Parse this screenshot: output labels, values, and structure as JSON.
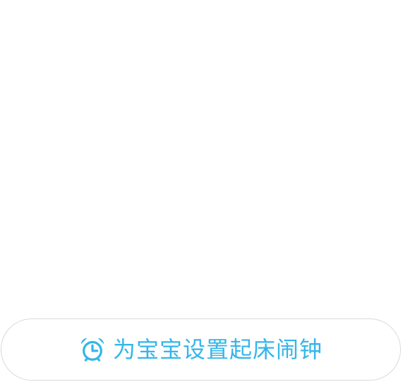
{
  "colors": {
    "accent": "#33b6ea",
    "border": "#d9d9d9",
    "background": "#ffffff"
  },
  "alarm_button": {
    "label": "为宝宝设置起床闹钟",
    "icon": "alarm-clock-icon"
  }
}
